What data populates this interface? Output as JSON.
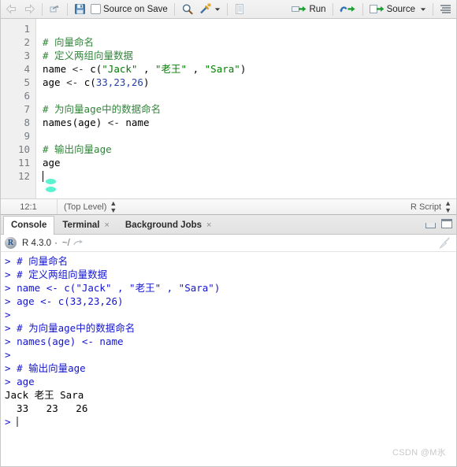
{
  "toolbar": {
    "back_icon": "back-arrow-icon",
    "forward_icon": "forward-arrow-icon",
    "show_in_new_window_icon": "popout-window-icon",
    "save_icon": "save-disk-icon",
    "source_on_save_label": "Source on Save",
    "find_icon": "magnifier-icon",
    "magic_icon": "code-tools-wand-icon",
    "magic_dropdown_icon": "chevron-down-icon",
    "compile_report_icon": "notebook-icon",
    "run_label": "Run",
    "run_icon": "run-arrow-icon",
    "rerun_icon": "rerun-loop-icon",
    "source_label": "Source",
    "source_icon": "source-arrow-icon",
    "source_dropdown_icon": "chevron-down-icon",
    "outline_icon": "document-outline-icon"
  },
  "editor": {
    "line_numbers": [
      "1",
      "2",
      "3",
      "4",
      "5",
      "6",
      "7",
      "8",
      "9",
      "10",
      "11",
      "12"
    ],
    "lines": [
      {
        "n": 1,
        "segments": []
      },
      {
        "n": 2,
        "segments": [
          {
            "t": "# 向量命名",
            "c": "cmt"
          }
        ]
      },
      {
        "n": 3,
        "segments": [
          {
            "t": "# 定义两组向量数据",
            "c": "cmt"
          }
        ]
      },
      {
        "n": 4,
        "segments": [
          {
            "t": "name ",
            "c": "fn"
          },
          {
            "t": "<- ",
            "c": "op"
          },
          {
            "t": "c(",
            "c": "fn"
          },
          {
            "t": "\"Jack\"",
            "c": "str"
          },
          {
            "t": " , ",
            "c": "fn"
          },
          {
            "t": "\"老王\"",
            "c": "str"
          },
          {
            "t": " , ",
            "c": "fn"
          },
          {
            "t": "\"Sara\"",
            "c": "str"
          },
          {
            "t": ")",
            "c": "fn"
          }
        ]
      },
      {
        "n": 5,
        "segments": [
          {
            "t": "age ",
            "c": "fn"
          },
          {
            "t": "<- ",
            "c": "op"
          },
          {
            "t": "c(",
            "c": "fn"
          },
          {
            "t": "33,23,26",
            "c": "num"
          },
          {
            "t": ")",
            "c": "fn"
          }
        ]
      },
      {
        "n": 6,
        "segments": []
      },
      {
        "n": 7,
        "segments": [
          {
            "t": "# 为向量age中的数据命名",
            "c": "cmt"
          }
        ]
      },
      {
        "n": 8,
        "segments": [
          {
            "t": "names(age) ",
            "c": "fn"
          },
          {
            "t": "<- ",
            "c": "op"
          },
          {
            "t": "name",
            "c": "fn"
          }
        ]
      },
      {
        "n": 9,
        "segments": []
      },
      {
        "n": 10,
        "segments": [
          {
            "t": "# 输出向量age",
            "c": "cmt"
          }
        ]
      },
      {
        "n": 11,
        "segments": [
          {
            "t": "age",
            "c": "fn"
          }
        ]
      },
      {
        "n": 12,
        "segments": []
      }
    ]
  },
  "source_status": {
    "cursor_position": "12:1",
    "scope": "(Top Level)",
    "file_type": "R Script"
  },
  "console_tabs": [
    {
      "label": "Console",
      "active": true,
      "closable": false
    },
    {
      "label": "Terminal",
      "active": false,
      "closable": true
    },
    {
      "label": "Background Jobs",
      "active": false,
      "closable": true
    }
  ],
  "console_window_buttons": {
    "minimize_icon": "minimize-pane-icon",
    "maximize_icon": "maximize-pane-icon"
  },
  "console_header": {
    "logo_text": "R",
    "version": "R 4.3.0",
    "separator": "·",
    "working_dir": "~/",
    "expand_icon": "expand-path-arrow-icon",
    "clear_icon": "broom-clear-console-icon"
  },
  "console_output": [
    {
      "prompt": "> ",
      "segments": [
        {
          "t": "# 向量命名",
          "c": "c-in"
        }
      ]
    },
    {
      "prompt": "> ",
      "segments": [
        {
          "t": "# 定义两组向量数据",
          "c": "c-in"
        }
      ]
    },
    {
      "prompt": "> ",
      "segments": [
        {
          "t": "name <- c(\"Jack\" , \"老王\" , \"Sara\")",
          "c": "c-in"
        }
      ]
    },
    {
      "prompt": "> ",
      "segments": [
        {
          "t": "age <- c(33,23,26)",
          "c": "c-in"
        }
      ]
    },
    {
      "prompt": "> ",
      "segments": []
    },
    {
      "prompt": "> ",
      "segments": [
        {
          "t": "# 为向量age中的数据命名",
          "c": "c-in"
        }
      ]
    },
    {
      "prompt": "> ",
      "segments": [
        {
          "t": "names(age) <- name",
          "c": "c-in"
        }
      ]
    },
    {
      "prompt": "> ",
      "segments": []
    },
    {
      "prompt": "> ",
      "segments": [
        {
          "t": "# 输出向量age",
          "c": "c-in"
        }
      ]
    },
    {
      "prompt": "> ",
      "segments": [
        {
          "t": "age",
          "c": "c-in"
        }
      ]
    },
    {
      "prompt": "",
      "segments": [
        {
          "t": "Jack 老王 Sara",
          "c": "c-out"
        }
      ]
    },
    {
      "prompt": "",
      "segments": [
        {
          "t": "  33   23   26",
          "c": "c-out"
        }
      ]
    },
    {
      "prompt": "> ",
      "segments": [],
      "caret": true
    }
  ],
  "watermark": "CSDN @M氷",
  "colors": {
    "comment_green": "#31843a",
    "string_green": "#007f00",
    "number_blue": "#2841a6",
    "console_input_blue": "#1414cf",
    "run_arrow_green": "#1f9d35",
    "accent_teal": "#3ef0c8"
  }
}
